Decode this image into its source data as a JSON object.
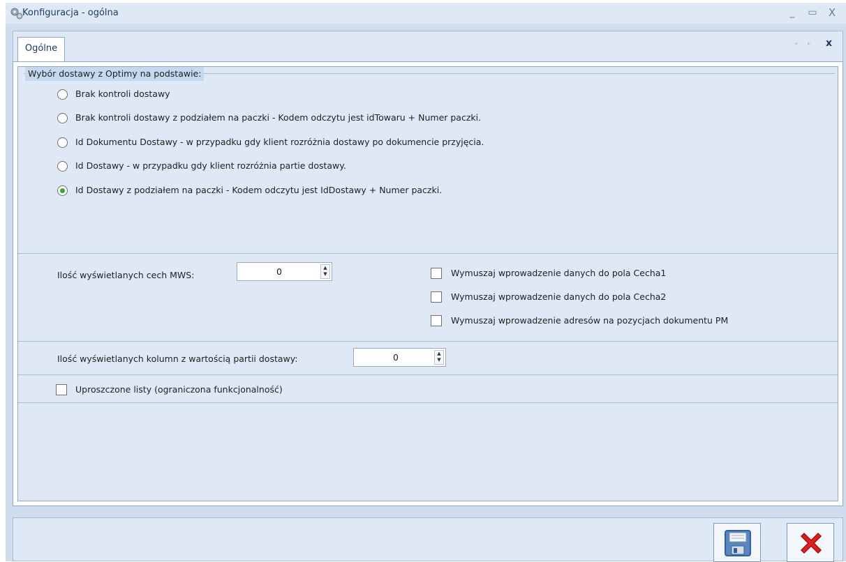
{
  "window": {
    "title": "Konfiguracja - ogólna",
    "minimize_glyph": "_",
    "maximize_glyph": "▭",
    "close_glyph": "X"
  },
  "tabs": {
    "active_label": "Ogólne",
    "prev_glyph": "◂",
    "next_glyph": "▸",
    "close_glyph": "x"
  },
  "delivery_group": {
    "legend": "Wybór dostawy z Optimy na podstawie:",
    "options": [
      "Brak kontroli dostawy",
      "Brak kontroli dostawy z podziałem na paczki - Kodem odczytu jest idTowaru + Numer paczki.",
      "Id Dokumentu Dostawy - w przypadku gdy klient rozróżnia dostawy po dokumencie przyjęcia.",
      "Id Dostawy - w przypadku gdy klient rozróżnia partie dostawy.",
      "Id Dostawy z podziałem na paczki - Kodem odczytu jest IdDostawy + Numer paczki."
    ],
    "selected_index": 4
  },
  "mws": {
    "label": "Ilość wyświetlanych cech MWS:",
    "value": "0",
    "checkboxes": [
      "Wymuszaj wprowadzenie danych do pola Cecha1",
      "Wymuszaj wprowadzenie danych do pola Cecha2",
      "Wymuszaj wprowadzenie adresów na pozycjach dokumentu PM"
    ]
  },
  "columns": {
    "label": "Ilość wyświetlanych kolumn z wartością partii dostawy:",
    "value": "0"
  },
  "simplified": {
    "label": "Uproszczone listy (ograniczona funkcjonalność)"
  },
  "spin_glyphs": {
    "up": "▲",
    "down": "▼"
  },
  "icons": {
    "app": "gears-icon",
    "save": "floppy-disk-icon",
    "cancel": "red-x-icon"
  },
  "colors": {
    "window_bg": "#cfddee",
    "panel_bg": "#dfe9f5",
    "radio_checked": "#33a531",
    "cancel_red": "#e02020"
  }
}
